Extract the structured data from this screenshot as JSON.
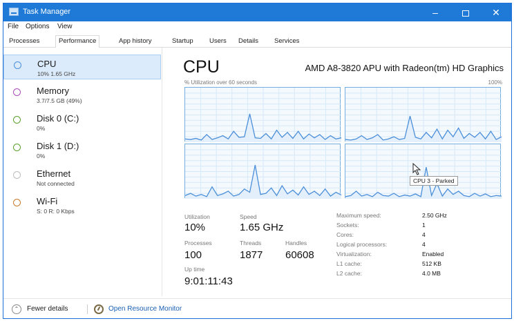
{
  "window": {
    "title": "Task Manager",
    "minimize": "–",
    "close": "✕"
  },
  "menu": [
    "File",
    "Options",
    "View"
  ],
  "tabs": [
    "Processes",
    "Performance",
    "App history",
    "Startup",
    "Users",
    "Details",
    "Services"
  ],
  "active_tab": "Performance",
  "sidebar": {
    "items": [
      {
        "name": "CPU",
        "sub": "10% 1.65 GHz",
        "color": "#4b8fd9"
      },
      {
        "name": "Memory",
        "sub": "3.7/7.5 GB (49%)",
        "color": "#a54bb8"
      },
      {
        "name": "Disk 0 (C:)",
        "sub": "0%",
        "color": "#5aa02c"
      },
      {
        "name": "Disk 1 (D:)",
        "sub": "0%",
        "color": "#5aa02c"
      },
      {
        "name": "Ethernet",
        "sub": "Not connected",
        "color": "#bcbcbc"
      },
      {
        "name": "Wi-Fi",
        "sub": "S: 0 R: 0 Kbps",
        "color": "#c8792a"
      }
    ]
  },
  "main": {
    "title": "CPU",
    "model": "AMD A8-3820 APU with Radeon(tm) HD Graphics",
    "util_caption": "% Utilization over 60 seconds",
    "util_max": "100%",
    "tooltip": "CPU 3 - Parked",
    "graph_color": "#4b8fd9",
    "graphs": [
      [
        6,
        5,
        7,
        4,
        14,
        5,
        8,
        12,
        6,
        20,
        9,
        10,
        52,
        8,
        7,
        16,
        6,
        22,
        9,
        18,
        7,
        20,
        6,
        15,
        8,
        14,
        5,
        12,
        6,
        8
      ],
      [
        5,
        4,
        6,
        12,
        5,
        8,
        14,
        4,
        6,
        10,
        5,
        7,
        48,
        9,
        6,
        18,
        8,
        24,
        6,
        22,
        10,
        26,
        7,
        16,
        9,
        18,
        6,
        20,
        5,
        10
      ],
      [
        6,
        10,
        5,
        8,
        4,
        22,
        6,
        9,
        14,
        5,
        8,
        18,
        12,
        62,
        8,
        10,
        20,
        6,
        24,
        9,
        16,
        7,
        22,
        8,
        14,
        6,
        18,
        5,
        12,
        7
      ],
      [
        4,
        6,
        14,
        5,
        8,
        4,
        12,
        6,
        5,
        10,
        4,
        7,
        5,
        9,
        4,
        58,
        6,
        28,
        5,
        18,
        8,
        14,
        6,
        4,
        10,
        5,
        9,
        4,
        6,
        5
      ]
    ],
    "stats": {
      "utilization_label": "Utilization",
      "utilization": "10%",
      "speed_label": "Speed",
      "speed": "1.65 GHz",
      "processes_label": "Processes",
      "processes": "100",
      "threads_label": "Threads",
      "threads": "1877",
      "handles_label": "Handles",
      "handles": "60608",
      "uptime_label": "Up time",
      "uptime": "9:01:11:43"
    },
    "details": [
      {
        "label": "Maximum speed:",
        "value": "2.50 GHz"
      },
      {
        "label": "Sockets:",
        "value": "1"
      },
      {
        "label": "Cores:",
        "value": "4"
      },
      {
        "label": "Logical processors:",
        "value": "4"
      },
      {
        "label": "Virtualization:",
        "value": "Enabled"
      },
      {
        "label": "L1 cache:",
        "value": "512 KB"
      },
      {
        "label": "L2 cache:",
        "value": "4.0 MB"
      }
    ]
  },
  "footer": {
    "fewer_details": "Fewer details",
    "open_monitor": "Open Resource Monitor"
  }
}
